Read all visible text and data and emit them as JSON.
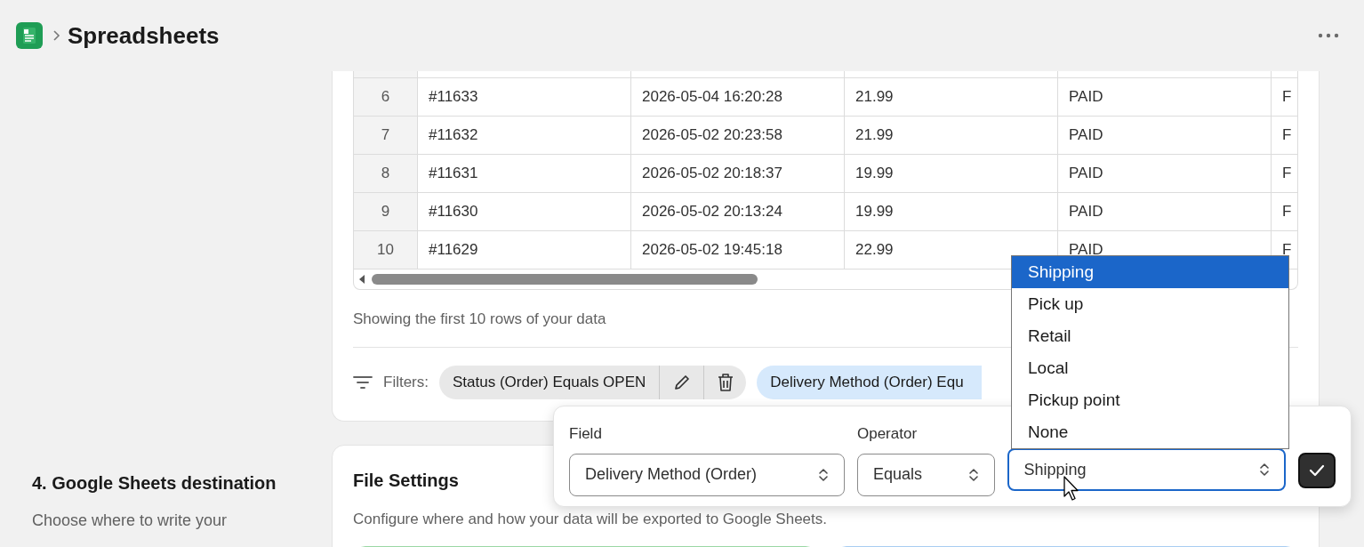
{
  "header": {
    "title": "Spreadsheets"
  },
  "table": {
    "rows": [
      {
        "number": "6",
        "cells": [
          "#11633",
          "2026-05-04 16:20:28",
          "21.99",
          "PAID",
          "F"
        ]
      },
      {
        "number": "7",
        "cells": [
          "#11632",
          "2026-05-02 20:23:58",
          "21.99",
          "PAID",
          "F"
        ]
      },
      {
        "number": "8",
        "cells": [
          "#11631",
          "2026-05-02 20:18:37",
          "19.99",
          "PAID",
          "F"
        ]
      },
      {
        "number": "9",
        "cells": [
          "#11630",
          "2026-05-02 20:13:24",
          "19.99",
          "PAID",
          "F"
        ]
      },
      {
        "number": "10",
        "cells": [
          "#11629",
          "2026-05-02 19:45:18",
          "22.99",
          "PAID",
          "F"
        ]
      }
    ]
  },
  "caption": "Showing the first 10 rows of your data",
  "filters": {
    "label": "Filters:",
    "chips": [
      {
        "kind": "saved",
        "text": "Status (Order) Equals OPEN"
      },
      {
        "kind": "editing",
        "text": "Delivery Method (Order) Equ"
      }
    ]
  },
  "editor": {
    "field_label": "Field",
    "field_value": "Delivery Method (Order)",
    "operator_label": "Operator",
    "operator_value": "Equals",
    "value": "Shipping",
    "options": [
      {
        "label": "Shipping",
        "selected": true
      },
      {
        "label": "Pick up",
        "selected": false
      },
      {
        "label": "Retail",
        "selected": false
      },
      {
        "label": "Local",
        "selected": false
      },
      {
        "label": "Pickup point",
        "selected": false
      },
      {
        "label": "None",
        "selected": false
      }
    ]
  },
  "section": {
    "title": "4. Google Sheets destination",
    "description": "Choose where to write your"
  },
  "file_settings": {
    "title": "File Settings",
    "description": "Configure where and how your data will be exported to Google Sheets."
  }
}
